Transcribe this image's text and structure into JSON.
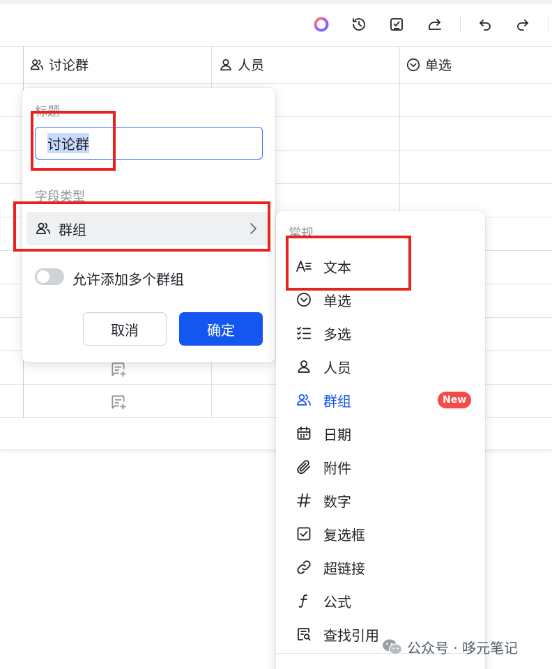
{
  "columns": [
    {
      "label": "讨论群",
      "icon": "group-icon"
    },
    {
      "label": "人员",
      "icon": "person-icon"
    },
    {
      "label": "单选",
      "icon": "single-select-icon"
    }
  ],
  "popover": {
    "title_label": "标题",
    "title_value": "讨论群",
    "field_type_label": "字段类型",
    "field_type_value": "群组",
    "toggle_label": "允许添加多个群组",
    "toggle_on": false,
    "cancel_label": "取消",
    "ok_label": "确定"
  },
  "menu": {
    "group_label": "常规",
    "items": [
      {
        "label": "文本",
        "icon": "text-icon"
      },
      {
        "label": "单选",
        "icon": "single-select-icon"
      },
      {
        "label": "多选",
        "icon": "multi-select-icon"
      },
      {
        "label": "人员",
        "icon": "person-icon"
      },
      {
        "label": "群组",
        "icon": "group-icon",
        "active": true,
        "badge": "New"
      },
      {
        "label": "日期",
        "icon": "calendar-icon"
      },
      {
        "label": "附件",
        "icon": "attachment-icon"
      },
      {
        "label": "数字",
        "icon": "hash-icon"
      },
      {
        "label": "复选框",
        "icon": "checkbox-icon"
      },
      {
        "label": "超链接",
        "icon": "link-icon"
      },
      {
        "label": "公式",
        "icon": "formula-icon"
      },
      {
        "label": "查找引用",
        "icon": "lookup-icon"
      }
    ]
  },
  "watermark": "公众号 · 哆元笔记",
  "colors": {
    "accent": "#1456f0",
    "annotation": "#e8231c",
    "badge": "#f54a45"
  }
}
